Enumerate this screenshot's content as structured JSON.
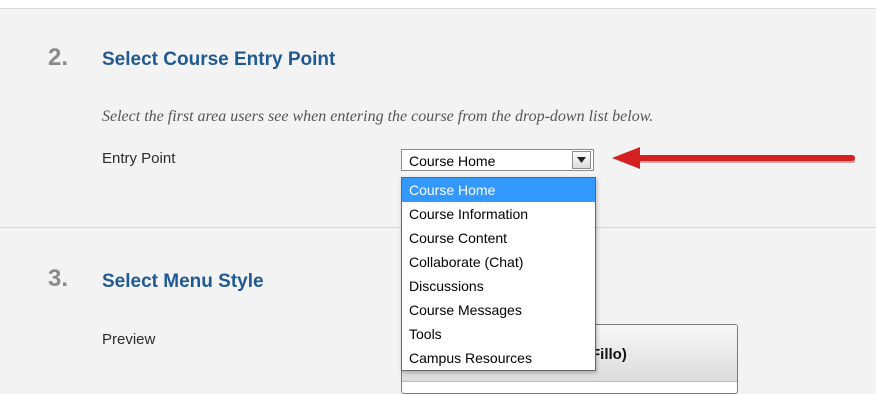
{
  "section2": {
    "number": "2.",
    "title": "Select Course Entry Point",
    "instructions": "Select the first area users see when entering the course from the drop-down list below.",
    "field_label": "Entry Point",
    "selected_value": "Course Home"
  },
  "dropdown": {
    "options": [
      "Course Home",
      "Course Information",
      "Course Content",
      "Collaborate (Chat)",
      "Discussions",
      "Course Messages",
      "Tools",
      "Campus Resources"
    ],
    "selected_index": 0
  },
  "section3": {
    "number": "3.",
    "title": "Select Menu Style",
    "field_label": "Preview",
    "preview_text": "EC.Fillo)"
  },
  "colors": {
    "title": "#1f5a92",
    "arrow": "#d42020",
    "highlight": "#3399ff"
  },
  "icons": {
    "dropdown_button": "chevron-down-icon",
    "annotation": "red-arrow-icon"
  }
}
